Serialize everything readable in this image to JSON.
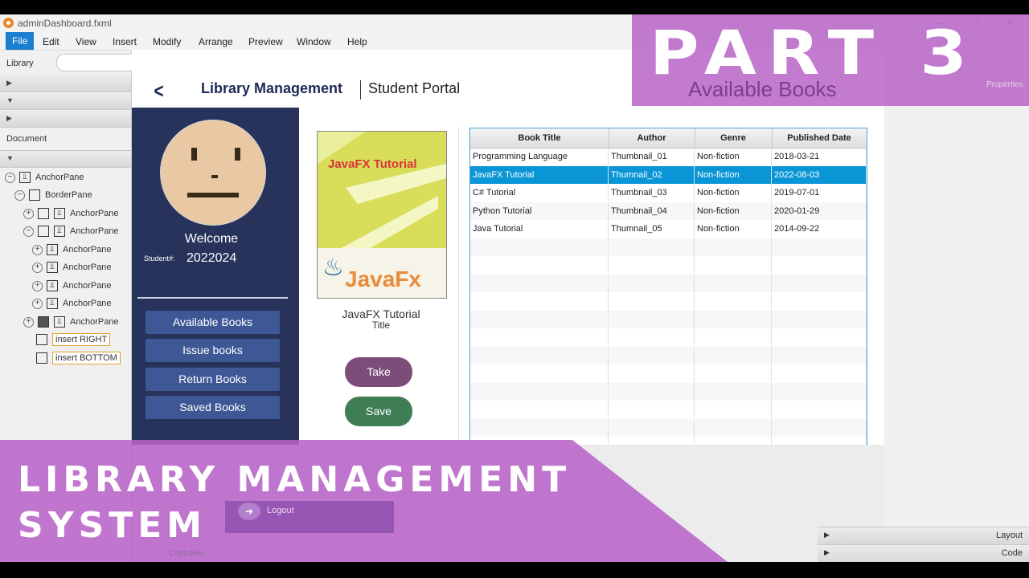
{
  "window": {
    "title": "adminDashboard.fxml",
    "controls": [
      "—",
      "❐",
      "✕"
    ]
  },
  "menu": [
    "File",
    "Edit",
    "View",
    "Insert",
    "Modify",
    "Arrange",
    "Preview",
    "Window",
    "Help"
  ],
  "left_panel": {
    "library_label": "Library",
    "document_label": "Document",
    "tree": [
      {
        "label": "AnchorPane",
        "level": 0,
        "toggle": "−"
      },
      {
        "label": "BorderPane",
        "level": 1,
        "toggle": "−"
      },
      {
        "label": "AnchorPane",
        "level": 2,
        "toggle": "+"
      },
      {
        "label": "AnchorPane",
        "level": 2,
        "toggle": "−"
      },
      {
        "label": "AnchorPane",
        "level": 3,
        "toggle": "+"
      },
      {
        "label": "AnchorPane",
        "level": 3,
        "toggle": "+"
      },
      {
        "label": "AnchorPane",
        "level": 3,
        "toggle": "+"
      },
      {
        "label": "AnchorPane",
        "level": 3,
        "toggle": "+"
      },
      {
        "label": "AnchorPane",
        "level": 3,
        "toggle": "+"
      }
    ],
    "inserts": [
      "insert RIGHT",
      "insert BOTTOM"
    ],
    "controller_label": "Controller"
  },
  "app": {
    "title": "Library Management",
    "subtitle": "Student Portal",
    "welcome": "Welcome",
    "student_label": "Student#:",
    "student_id": "2022024",
    "nav": [
      "Available Books",
      "Issue books",
      "Return Books",
      "Saved Books"
    ],
    "logout": "Logout",
    "cover": {
      "heading": "JavaFX Tutorial",
      "logo": "JavaFx"
    },
    "book_title": "JavaFX Tutorial",
    "book_title_caption": "Title",
    "take": "Take",
    "save": "Save",
    "table": {
      "columns": [
        "Book Title",
        "Author",
        "Genre",
        "Published Date"
      ],
      "rows": [
        [
          "Programming Language",
          "Thumbnail_01",
          "Non-fiction",
          "2018-03-21"
        ],
        [
          "JavaFX Tutorial",
          "Thumnail_02",
          "Non-fiction",
          "2022-08-03"
        ],
        [
          "C# Tutorial",
          "Thumbnail_03",
          "Non-fiction",
          "2019-07-01"
        ],
        [
          "Python Tutorial",
          "Thumbnail_04",
          "Non-fiction",
          "2020-01-29"
        ],
        [
          "Java Tutorial",
          "Thumnail_05",
          "Non-fiction",
          "2014-09-22"
        ]
      ],
      "selected_row": 1
    }
  },
  "right_panel": {
    "properties_label": "Properties",
    "layout_label": "Layout",
    "code_label": "Code"
  },
  "overlay": {
    "part": "PART 3",
    "section": "Available Books",
    "title_line1": "LIBRARY MANAGEMENT",
    "title_line2": "SYSTEM"
  },
  "colors": {
    "sidebar": "#27335a",
    "nav_button": "#3e5896",
    "take": "#7d4d7a",
    "save": "#3f7d55",
    "selection": "#0a96d6",
    "overlay_purple": "#b864c8"
  }
}
